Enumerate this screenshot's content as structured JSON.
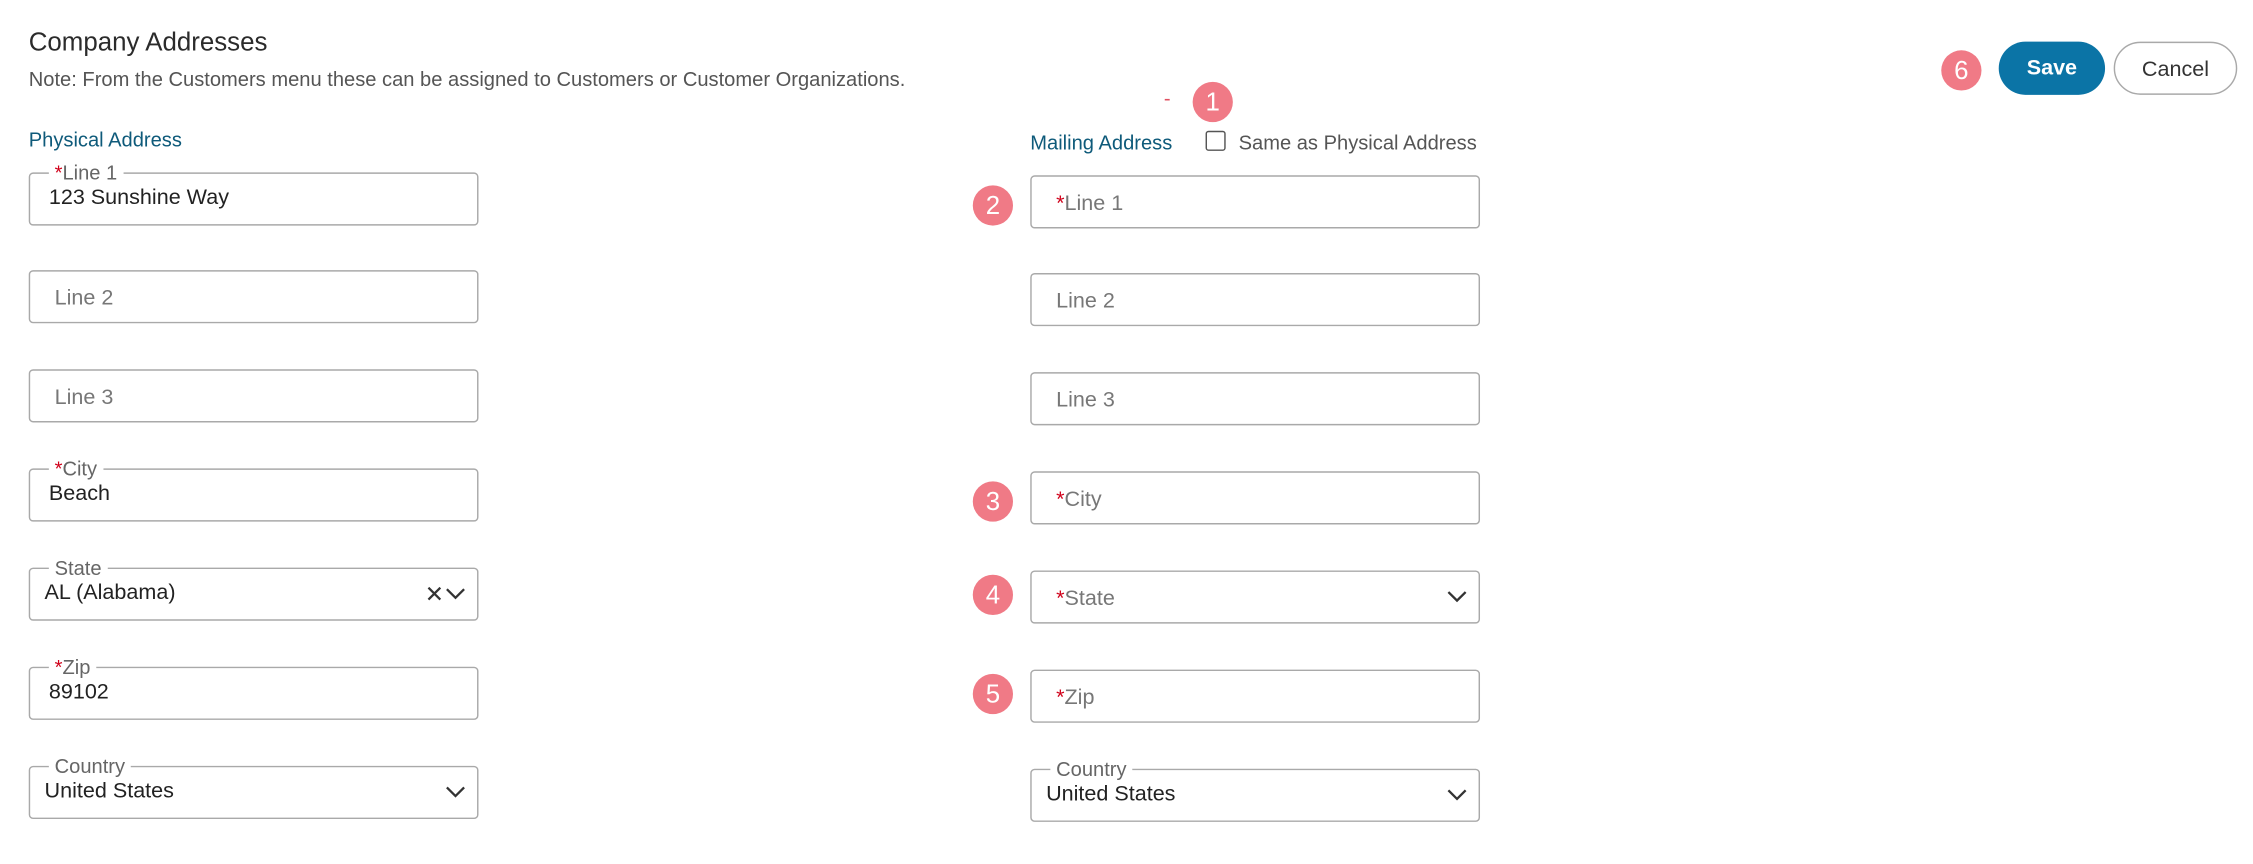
{
  "header": {
    "title": "Company Addresses",
    "note": "Note: From the Customers menu these can be assigned to Customers or Customer Organizations."
  },
  "actions": {
    "save_label": "Save",
    "cancel_label": "Cancel"
  },
  "physical": {
    "heading": "Physical Address",
    "line1": {
      "label": "Line 1",
      "value": "123 Sunshine Way"
    },
    "line2": {
      "placeholder": "Line 2"
    },
    "line3": {
      "placeholder": "Line 3"
    },
    "city": {
      "label": "City",
      "value": "Beach"
    },
    "state": {
      "label": "State",
      "value": "AL (Alabama)"
    },
    "zip": {
      "label": "Zip",
      "value": "89102"
    },
    "country": {
      "label": "Country",
      "value": "United States"
    }
  },
  "mailing": {
    "heading": "Mailing Address",
    "same_as_label": "Same as Physical Address",
    "same_as_checked": false,
    "line1": {
      "placeholder": "Line 1"
    },
    "line2": {
      "placeholder": "Line 2"
    },
    "line3": {
      "placeholder": "Line 3"
    },
    "city": {
      "placeholder": "City"
    },
    "state": {
      "placeholder": "State"
    },
    "zip": {
      "placeholder": "Zip"
    },
    "country": {
      "label": "Country",
      "value": "United States"
    }
  },
  "annotations": {
    "marker": "-",
    "badges": [
      "1",
      "2",
      "3",
      "4",
      "5",
      "6"
    ],
    "color": "#f07a86"
  },
  "required_mark": "*",
  "colors": {
    "primary": "#0b74a6",
    "section": "#0e5a7a",
    "required": "#d0021b"
  },
  "icons": {
    "dropdown": "chevron-down-icon",
    "clear": "clear-x-icon"
  }
}
